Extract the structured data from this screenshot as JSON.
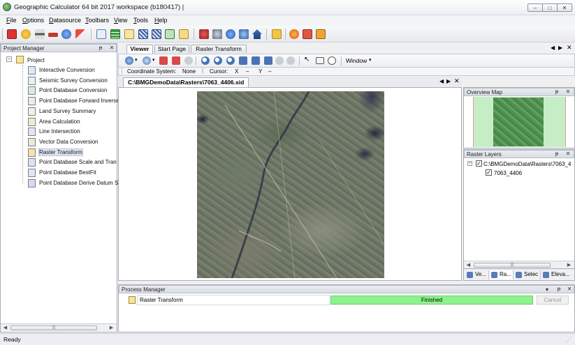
{
  "window": {
    "title": "Geographic Calculator 64 bit 2017  workspace (b180417) |",
    "minimize": "–",
    "maximize": "□",
    "close": "✕"
  },
  "menu": [
    "File",
    "Options",
    "Datasource",
    "Toolbars",
    "View",
    "Tools",
    "Help"
  ],
  "project_manager": {
    "title": "Project Manager",
    "root": "Project",
    "items": [
      {
        "label": "Interactive Conversion",
        "icon": "interactive-conversion-icon"
      },
      {
        "label": "Seismic Survey Conversion",
        "icon": "seismic-survey-icon"
      },
      {
        "label": "Point Database Conversion",
        "icon": "point-database-icon"
      },
      {
        "label": "Point Database Forward Inverse",
        "icon": "forward-inverse-icon"
      },
      {
        "label": "Land Survey Summary",
        "icon": "land-survey-icon"
      },
      {
        "label": "Area Calculation",
        "icon": "area-calculation-icon"
      },
      {
        "label": "Line Intersection",
        "icon": "line-intersection-icon"
      },
      {
        "label": "Vector Data Conversion",
        "icon": "vector-data-icon"
      },
      {
        "label": "Raster Transform",
        "icon": "raster-transform-icon"
      },
      {
        "label": "Point Database Scale and Tran",
        "icon": "scale-transform-icon"
      },
      {
        "label": "Point Database BestFit",
        "icon": "bestfit-icon"
      },
      {
        "label": "Point Database Derive Datum S",
        "icon": "derive-datum-icon"
      }
    ],
    "selected_index": 8
  },
  "tabs": [
    "Viewer",
    "Start Page",
    "Raster Transform"
  ],
  "active_tab": 0,
  "viewer_toolbar": {
    "window_label": "Window"
  },
  "coordbar": {
    "coord_system_label": "Coordinate System:",
    "coord_system_value": "None",
    "cursor_label": "Cursor:",
    "x_label": "X",
    "x_value": "–",
    "y_label": "Y",
    "y_value": "–"
  },
  "document_tab": "C:\\BMGDemoData\\Rasters\\7063_4406.sid",
  "overview_map": {
    "title": "Overview Map"
  },
  "raster_layers": {
    "title": "Raster Layers",
    "parent": "C:\\BMGDemoData\\Rasters\\7063_4",
    "child": "7063_4406"
  },
  "right_tabs": [
    "Ve...",
    "Ra...",
    "Selec",
    "Eleva..."
  ],
  "process_manager": {
    "title": "Process Manager",
    "job_name": "Raster Transform",
    "status": "Finished",
    "cancel_label": "Cancel"
  },
  "statusbar": {
    "text": "Ready"
  },
  "colors": {
    "progress": "#8df28d",
    "overview_bg": "#c6eec6",
    "selection": "#dfe6f1"
  }
}
